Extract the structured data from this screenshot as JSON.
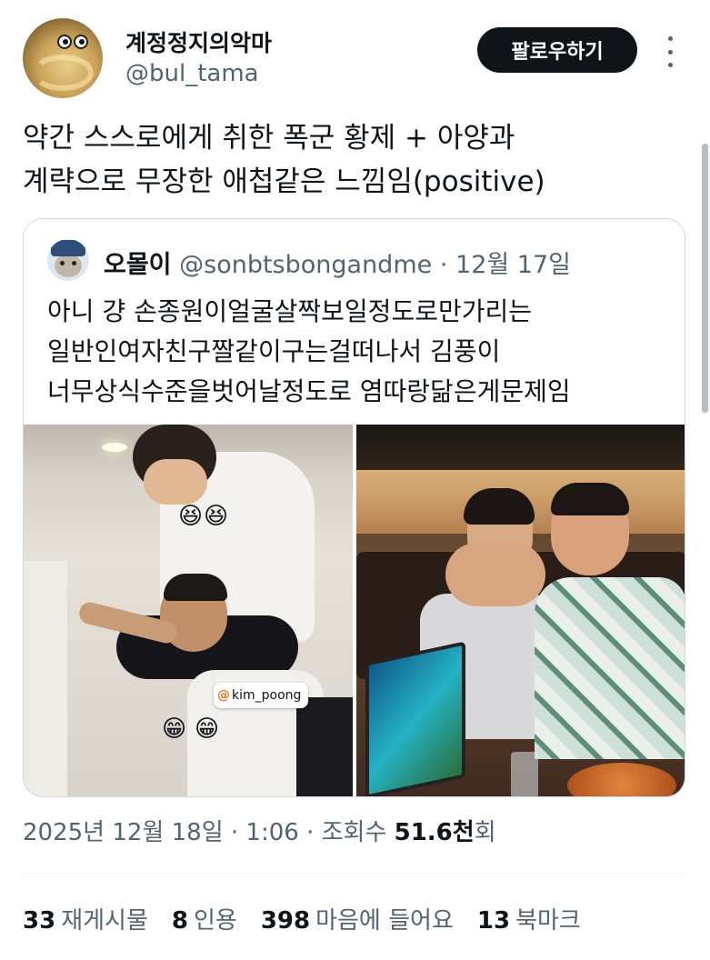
{
  "author": {
    "display_name": "계정정지의악마",
    "handle": "@bul_tama"
  },
  "follow_button": "팔로우하기",
  "post_text": "약간 스스로에게 취한 폭군 황제 + 아양과\n계략으로 무장한 애첩같은 느낌임(positive)",
  "quote": {
    "name": "오몰이",
    "handle": "@sonbtsbongandme",
    "separator": "·",
    "date": "12월 17일",
    "text": "아니 걍 손종원이얼굴살짝보일정도로만가리는\n일반인여자친구짤같이구는걸떠나서 김풍이\n너무상식수준을벗어날정도로 염따랑닮은게문제임",
    "photo_tag": "kim_poong",
    "emoji_laugh": "😆",
    "emoji_grin": "😁"
  },
  "timestamp": {
    "date_time": "2025년 12월 18일 · 1:06 · 조회수 ",
    "views_num": "51.6천",
    "views_suffix": "회"
  },
  "stats": {
    "retweets_num": "33",
    "retweets_label": "재게시물",
    "quotes_num": "8",
    "quotes_label": "인용",
    "likes_num": "398",
    "likes_label": "마음에 들어요",
    "bookmarks_num": "13",
    "bookmarks_label": "북마크"
  }
}
